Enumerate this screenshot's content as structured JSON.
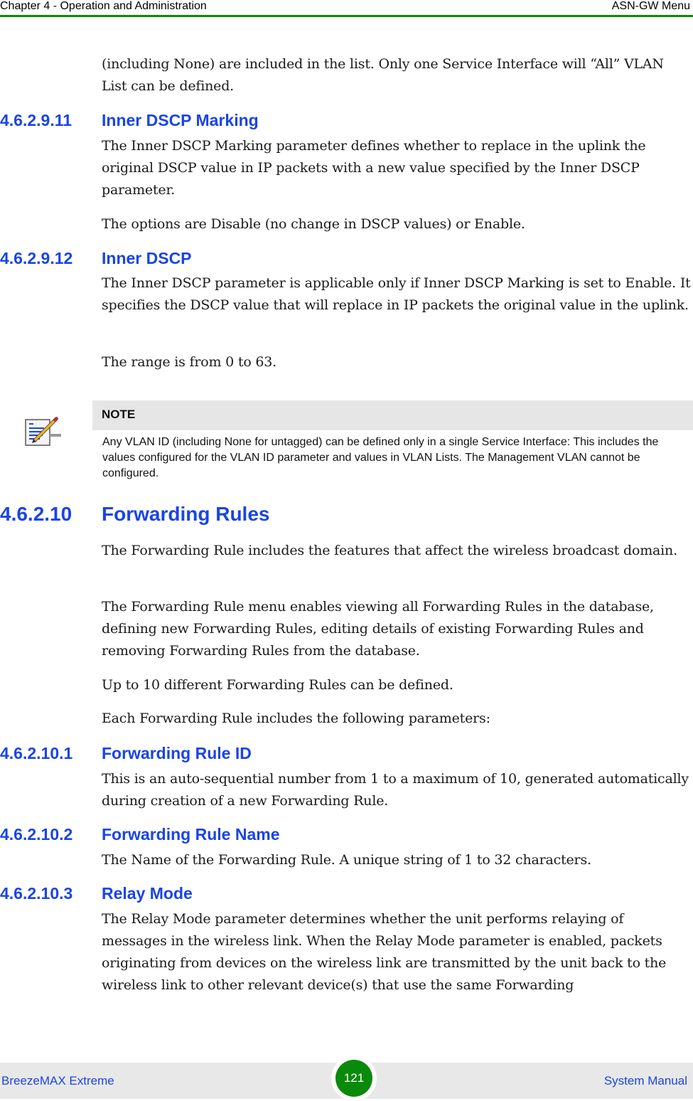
{
  "header": {
    "chapter": "Chapter 4 - Operation and Administration",
    "section": "ASN-GW Menu"
  },
  "content": {
    "intro_paragraph": "(including None) are included in the list. Only one Service Interface will “All” VLAN List can be defined.",
    "sections": [
      {
        "number": "4.6.2.9.11",
        "title": "Inner DSCP Marking",
        "paragraphs": [
          "The Inner DSCP Marking parameter defines whether to replace in the uplink the original DSCP value in IP packets with a new value specified by the Inner DSCP parameter.",
          "The options are Disable (no change in DSCP values) or Enable."
        ]
      },
      {
        "number": "4.6.2.9.12",
        "title": "Inner DSCP",
        "paragraphs": [
          "The Inner DSCP parameter is applicable only if Inner DSCP Marking is set to Enable. It specifies the DSCP value that will replace in IP packets the original value in the uplink.",
          "The range is from 0 to 63."
        ]
      },
      {
        "number": "4.6.2.10",
        "title": "Forwarding Rules",
        "paragraphs": [
          "The Forwarding Rule includes the features that affect the wireless broadcast domain.",
          "The Forwarding Rule menu enables viewing all Forwarding Rules in the database, defining new Forwarding Rules, editing details of existing Forwarding Rules and removing Forwarding Rules from the database.",
          "Up to 10 different Forwarding Rules can be defined.",
          "Each Forwarding Rule includes the following parameters:"
        ]
      },
      {
        "number": "4.6.2.10.1",
        "title": "Forwarding Rule ID",
        "paragraphs": [
          "This is an auto-sequential number from 1 to a maximum of 10, generated automatically during creation of a new Forwarding Rule."
        ]
      },
      {
        "number": "4.6.2.10.2",
        "title": "Forwarding Rule Name",
        "paragraphs": [
          "The Name of the Forwarding Rule. A unique string of 1 to 32 characters."
        ]
      },
      {
        "number": "4.6.2.10.3",
        "title": "Relay Mode",
        "paragraphs": [
          "The Relay Mode parameter determines whether the unit performs relaying of messages in the wireless link. When the Relay Mode parameter is enabled, packets originating from devices on the wireless link are transmitted by the unit back to the wireless link to other relevant device(s) that use the same Forwarding"
        ]
      }
    ],
    "note": {
      "icon": "note-pencil-icon",
      "heading": "NOTE",
      "text": "Any VLAN ID (including None for untagged) can be defined only in a single Service Interface: This includes the values configured for the VLAN ID parameter and values in VLAN Lists. The Management VLAN cannot be configured."
    }
  },
  "footer": {
    "product": "BreezeMAX Extreme",
    "page_number": "121",
    "document": "System Manual"
  },
  "colors": {
    "heading": "#1a44e6",
    "rule": "#0a8a0a",
    "footer_bg": "#e8e8e8",
    "note_bg": "#e6e6e6"
  }
}
